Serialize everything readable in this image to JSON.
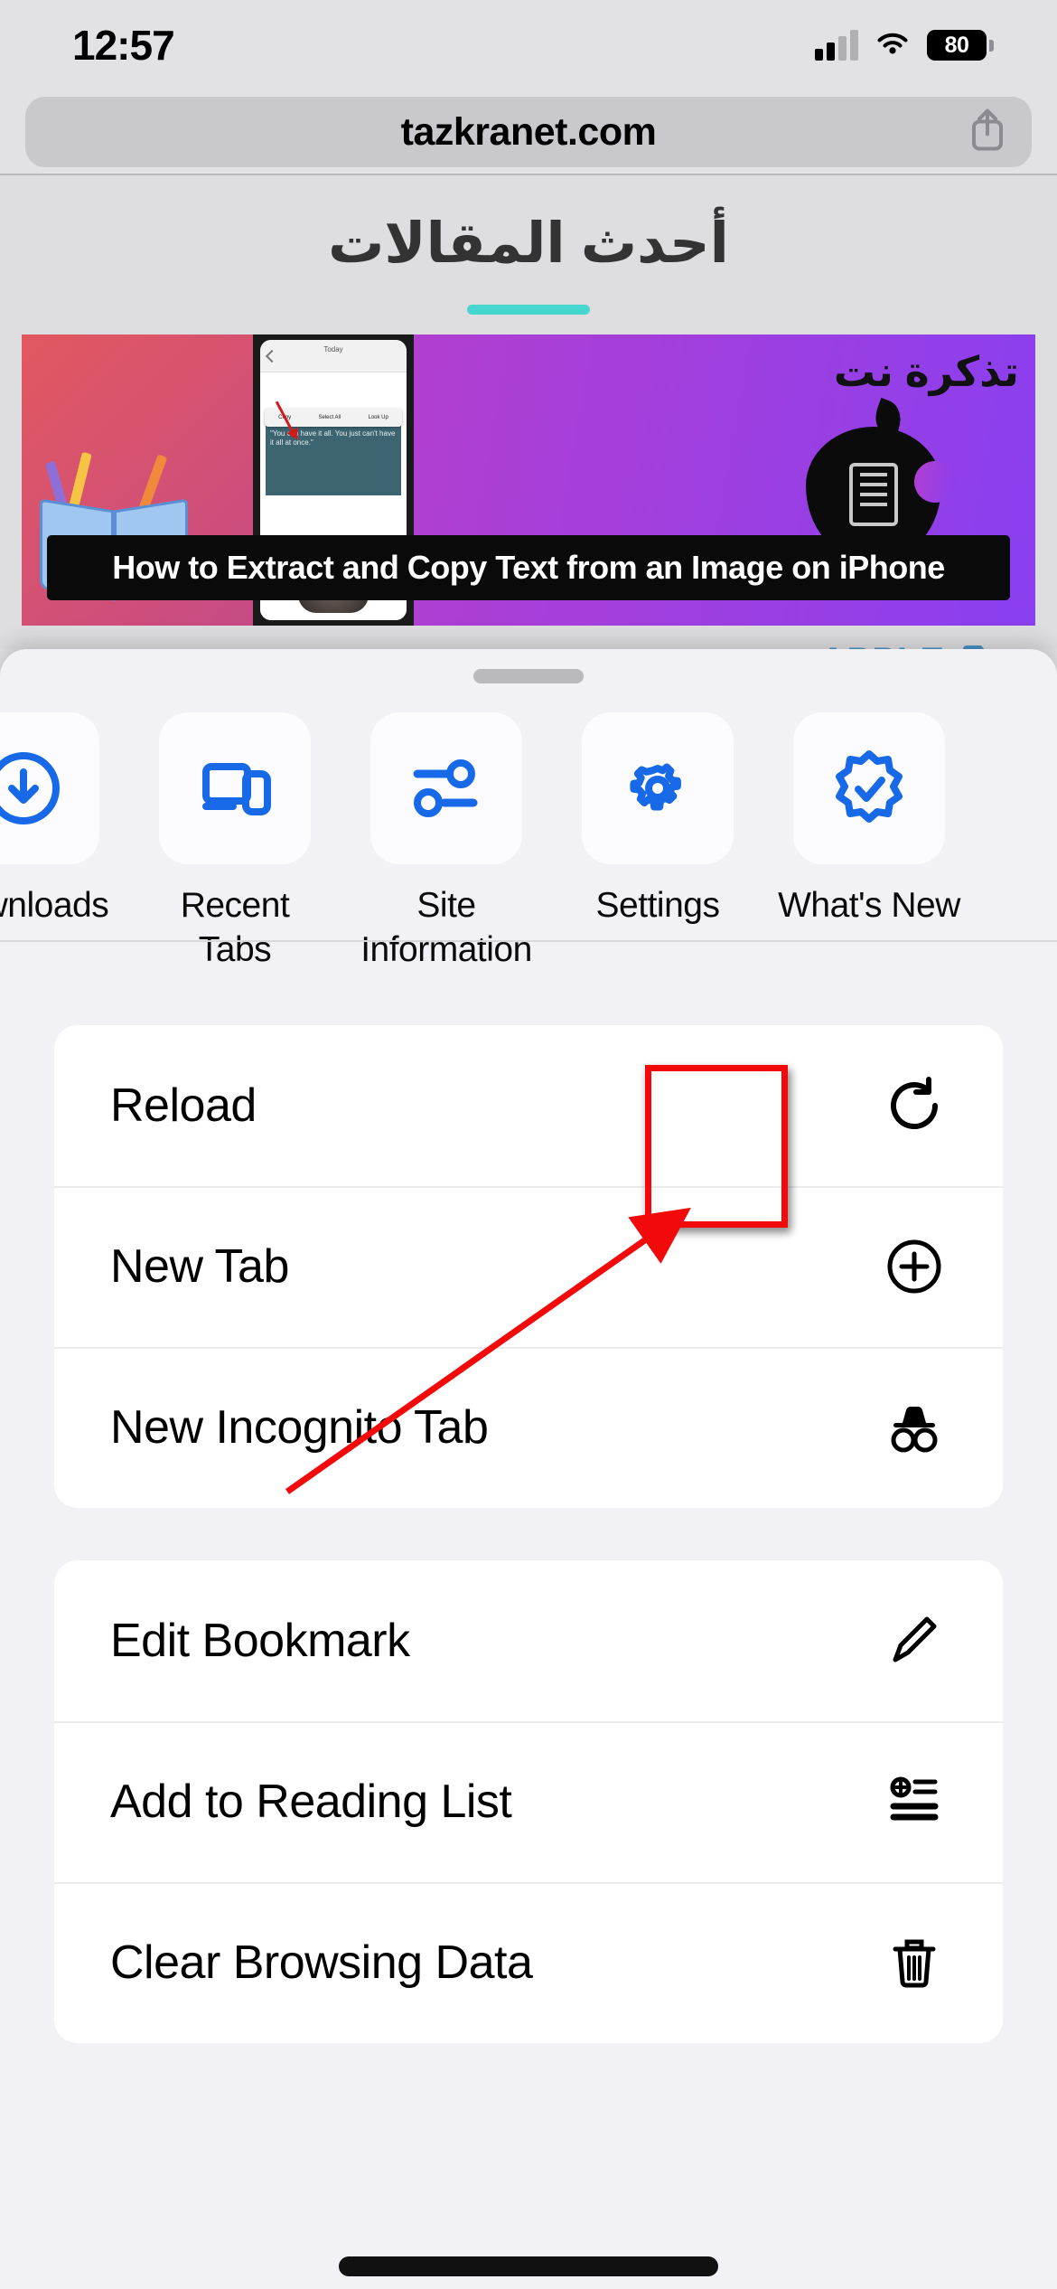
{
  "status_bar": {
    "time": "12:57",
    "battery_percent": "80",
    "signal_icon": "cellular-bars-icon",
    "wifi_icon": "wifi-icon",
    "battery_icon": "battery-icon"
  },
  "browser": {
    "url": "tazkranet.com",
    "share_icon": "share-icon"
  },
  "webpage": {
    "heading": "أحدث المقالات",
    "article": {
      "caption": "How to Extract and Copy Text from an Image on iPhone",
      "site_logo_text": "تذكرة نت",
      "phone_popup_items": [
        "Copy",
        "Select All",
        "Look Up"
      ],
      "phone_today_label": "Today",
      "phone_quote": "\"You can have it all. You just can't have it all at once.\""
    },
    "category": {
      "label": "APPLE",
      "icon": "folder-icon",
      "color": "#4a90c4"
    }
  },
  "menu_sheet": {
    "grabber": "drag-handle",
    "shortcuts": [
      {
        "label": "Downloads",
        "icon": "download-circle-icon"
      },
      {
        "label": "Recent Tabs",
        "icon": "devices-icon"
      },
      {
        "label": "Site Information",
        "icon": "sliders-icon"
      },
      {
        "label": "Settings",
        "icon": "gear-icon",
        "highlighted": true
      },
      {
        "label": "What's New",
        "icon": "verified-check-icon"
      }
    ],
    "groups": [
      {
        "items": [
          {
            "label": "Reload",
            "icon": "reload-icon"
          },
          {
            "label": "New Tab",
            "icon": "plus-circle-icon"
          },
          {
            "label": "New Incognito Tab",
            "icon": "incognito-icon"
          }
        ]
      },
      {
        "items": [
          {
            "label": "Edit Bookmark",
            "icon": "pencil-icon"
          },
          {
            "label": "Add to Reading List",
            "icon": "add-to-list-icon"
          },
          {
            "label": "Clear Browsing Data",
            "icon": "trash-icon"
          }
        ]
      }
    ]
  },
  "annotations": {
    "highlight_color": "#f20a0a",
    "highlight_target": "Settings",
    "arrow_points_to": "Settings"
  }
}
